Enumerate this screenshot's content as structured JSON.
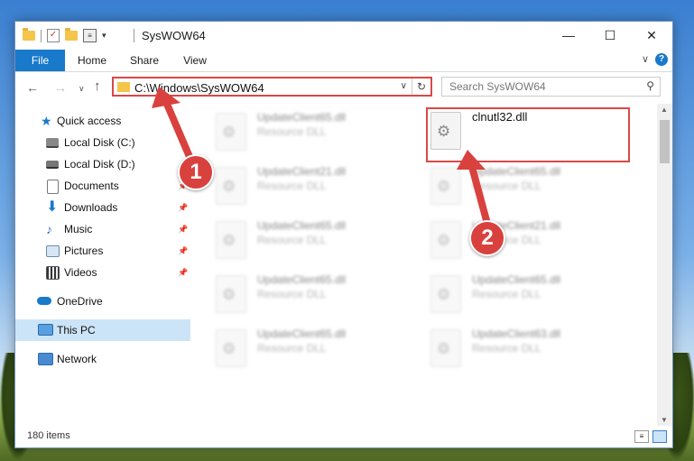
{
  "window": {
    "title": "SysWOW64",
    "controls": {
      "minimize": "—",
      "maximize": "☐",
      "close": "✕"
    }
  },
  "ribbon": {
    "tabs": [
      "File",
      "Home",
      "Share",
      "View"
    ],
    "chevron": "∨",
    "help": "?"
  },
  "address": {
    "path": "C:\\Windows\\SysWOW64",
    "dropdown": "∨",
    "refresh": "↻"
  },
  "search": {
    "placeholder": "Search SysWOW64",
    "icon": "search-icon"
  },
  "nav_buttons": {
    "back": "←",
    "forward": "→",
    "recent": "∨",
    "up": "↑"
  },
  "sidebar": {
    "items": [
      {
        "label": "Quick access",
        "icon": "star-icon",
        "pinned": false
      },
      {
        "label": "Local Disk (C:)",
        "icon": "drive-icon",
        "pinned": false
      },
      {
        "label": "Local Disk (D:)",
        "icon": "drive-icon",
        "pinned": false
      },
      {
        "label": "Documents",
        "icon": "documents-icon",
        "pinned": true
      },
      {
        "label": "Downloads",
        "icon": "downloads-icon",
        "pinned": true
      },
      {
        "label": "Music",
        "icon": "music-icon",
        "pinned": true
      },
      {
        "label": "Pictures",
        "icon": "pictures-icon",
        "pinned": true
      },
      {
        "label": "Videos",
        "icon": "videos-icon",
        "pinned": true
      },
      {
        "label": "OneDrive",
        "icon": "onedrive-icon",
        "pinned": false
      },
      {
        "label": "This PC",
        "icon": "pc-icon",
        "pinned": false,
        "selected": true
      },
      {
        "label": "Network",
        "icon": "network-icon",
        "pinned": false
      }
    ],
    "pin_glyph": "📌"
  },
  "files": {
    "highlighted": {
      "name": "clnutl32.dll",
      "type": ""
    },
    "left_column": [
      {
        "name": "UpdateClient65.dll",
        "type": "Resource DLL"
      },
      {
        "name": "UpdateClient21.dll",
        "type": "Resource DLL"
      },
      {
        "name": "UpdateClient65.dll",
        "type": "Resource DLL"
      },
      {
        "name": "UpdateClient65.dll",
        "type": "Resource DLL"
      },
      {
        "name": "UpdateClient65.dll",
        "type": "Resource DLL"
      }
    ],
    "right_column": [
      {
        "name": "UpdateClient65.dll",
        "type": "Resource DLL"
      },
      {
        "name": "UpdateClient21.dll",
        "type": "Resource DLL"
      },
      {
        "name": "UpdateClient65.dll",
        "type": "Resource DLL"
      },
      {
        "name": "UpdateClient63.dll",
        "type": "Resource DLL"
      }
    ]
  },
  "status": {
    "count": "180 items"
  },
  "callouts": [
    "1",
    "2"
  ],
  "colors": {
    "accent": "#1979ca",
    "highlight": "#d94848",
    "selected": "#cce4f7"
  }
}
